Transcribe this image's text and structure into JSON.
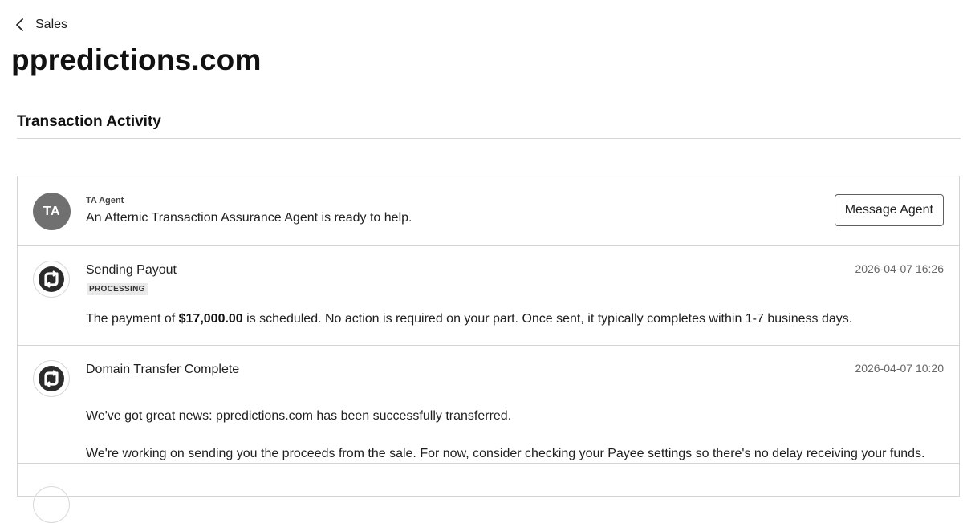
{
  "breadcrumb": {
    "back_label": "Sales"
  },
  "page": {
    "title": "ppredictions.com"
  },
  "section": {
    "heading": "Transaction Activity"
  },
  "agent": {
    "initials": "TA",
    "label": "TA Agent",
    "message": "An Afternic Transaction Assurance Agent is ready to help.",
    "button_label": "Message Agent"
  },
  "events": [
    {
      "title": "Sending Payout",
      "timestamp": "2026-04-07 16:26",
      "badge": "PROCESSING",
      "text_before": "The payment of ",
      "amount": "$17,000.00",
      "text_after": " is scheduled. No action is required on your part. Once sent, it typically completes within 1-7 business days.",
      "icon": "afternic-logo-icon"
    },
    {
      "title": "Domain Transfer Complete",
      "timestamp": "2026-04-07 10:20",
      "line1": "We've got great news: ppredictions.com has been successfully transferred.",
      "line2": "We're working on sending you the proceeds from the sale. For now, consider checking your Payee settings so there's no delay receiving your funds.",
      "icon": "afternic-logo-icon"
    }
  ],
  "colors": {
    "avatar_bg": "#707070",
    "badge_bg": "#eaeaea",
    "border": "#d4d4d4",
    "timestamp": "#666666"
  }
}
